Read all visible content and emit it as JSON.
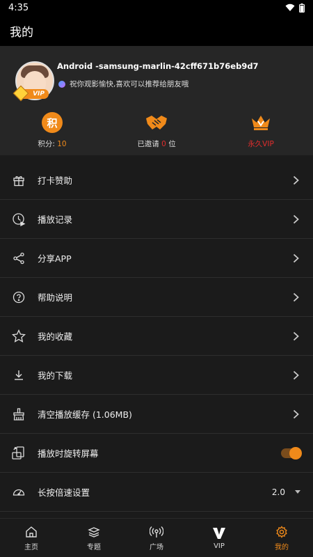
{
  "status": {
    "time": "4:35"
  },
  "app_bar": {
    "title": "我的"
  },
  "profile": {
    "username": "Android -samsung-marlin-42cff671b76eb9d7",
    "motto": "祝你观影愉快,喜欢可以推荐给朋友哦",
    "vip_badge": "VIP"
  },
  "stats": {
    "points": {
      "icon_text": "积",
      "label": "积分:",
      "value": "10"
    },
    "invited": {
      "label_prefix": "已邀请",
      "value": "0",
      "label_suffix": "位"
    },
    "vip": {
      "label": "永久VIP"
    }
  },
  "menu": [
    {
      "label": "打卡赞助",
      "icon": "gift-icon"
    },
    {
      "label": "播放记录",
      "icon": "history-icon"
    },
    {
      "label": "分享APP",
      "icon": "share-icon"
    },
    {
      "label": "帮助说明",
      "icon": "help-icon"
    },
    {
      "label": "我的收藏",
      "icon": "star-icon"
    },
    {
      "label": "我的下载",
      "icon": "download-icon"
    },
    {
      "label": "清空播放缓存 (1.06MB)",
      "icon": "broom-icon"
    },
    {
      "label": "播放时旋转屏幕",
      "icon": "rotate-screen-icon"
    },
    {
      "label": "长按倍速设置",
      "icon": "speedometer-icon",
      "value": "2.0"
    }
  ],
  "nav": [
    {
      "label": "主页",
      "icon": "home-icon"
    },
    {
      "label": "专题",
      "icon": "topics-icon"
    },
    {
      "label": "广场",
      "icon": "broadcast-icon"
    },
    {
      "label": "VIP",
      "icon": "vip-v-icon"
    },
    {
      "label": "我的",
      "icon": "settings-gear-icon"
    }
  ],
  "colors": {
    "accent": "#f08a1a",
    "highlight_red": "#e12d2d",
    "background": "#1b1b1b"
  }
}
